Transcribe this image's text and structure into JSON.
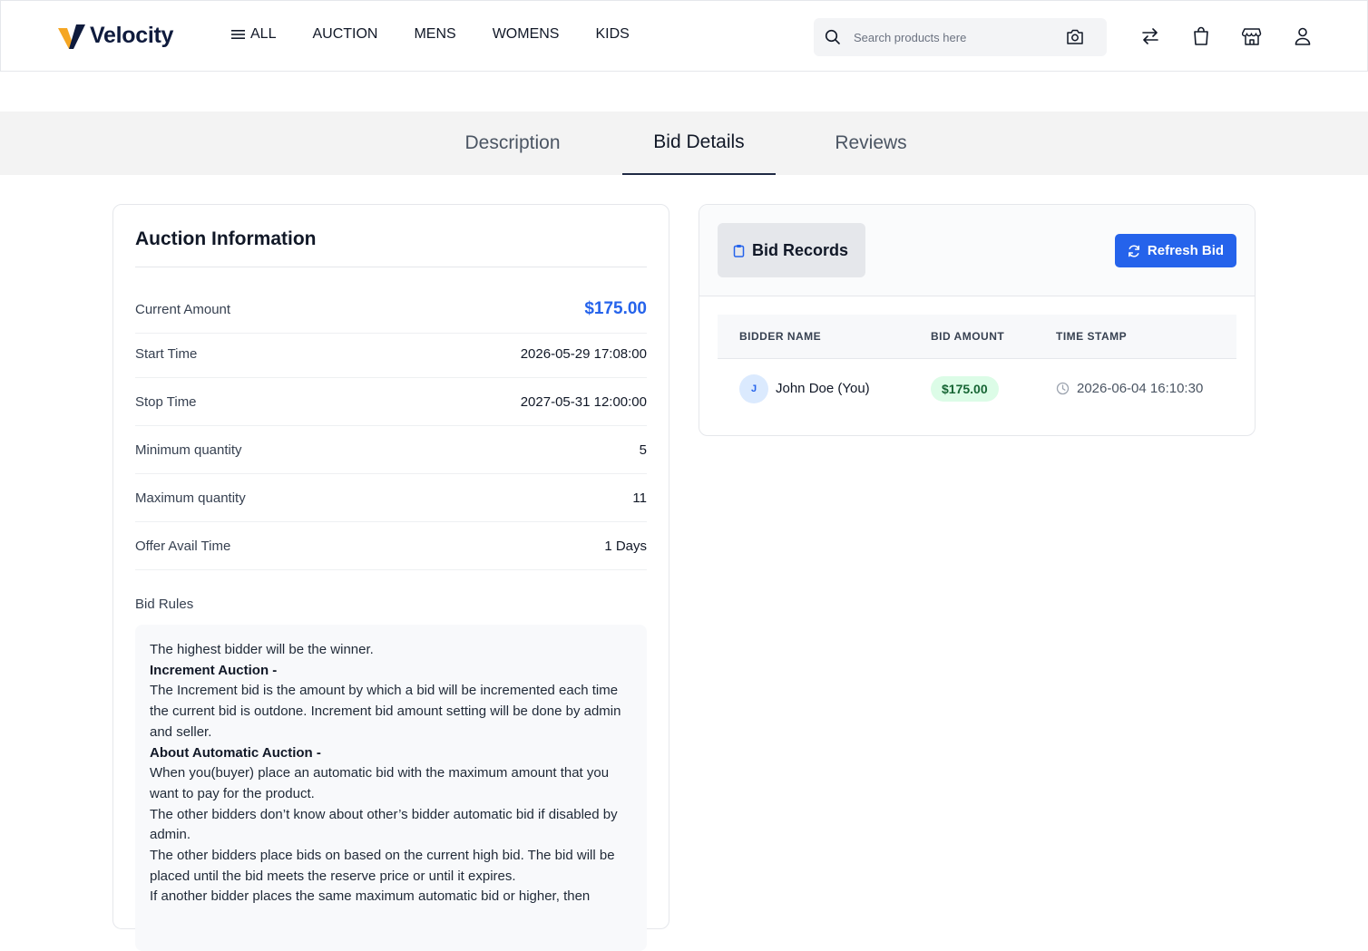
{
  "header": {
    "brand": "Velocity",
    "nav": [
      {
        "label": "ALL"
      },
      {
        "label": "AUCTION"
      },
      {
        "label": "MENS"
      },
      {
        "label": "WOMENS"
      },
      {
        "label": "KIDS"
      }
    ],
    "search_placeholder": "Search products here",
    "icons": [
      "search-icon",
      "camera-icon",
      "compare-icon",
      "bag-icon",
      "store-icon",
      "user-icon"
    ]
  },
  "tabs": [
    {
      "label": "Description"
    },
    {
      "label": "Bid Details",
      "active": true
    },
    {
      "label": "Reviews"
    }
  ],
  "auction": {
    "title": "Auction Information",
    "rows": [
      {
        "label": "Current Amount",
        "value": "$175.00"
      },
      {
        "label": "Start Time",
        "value": "2026-05-29 17:08:00"
      },
      {
        "label": "Stop Time",
        "value": "2027-05-31 12:00:00"
      },
      {
        "label": "Minimum quantity",
        "value": "5"
      },
      {
        "label": "Maximum quantity",
        "value": "11"
      },
      {
        "label": "Offer Avail Time",
        "value": "1 Days"
      }
    ],
    "rules_label": "Bid Rules",
    "rules": [
      "The highest bidder will be the winner.",
      "Increment Auction -",
      "The Increment bid is the amount by which a bid will be incremented each time the current bid is outdone. Increment bid amount setting will be done by admin and seller.",
      "About Automatic Auction -",
      "When you(buyer) place an automatic bid with the maximum amount that you want to pay for the product.",
      "The other bidders don’t know about other’s bidder automatic bid if disabled by admin.",
      "The other bidders place bids on based on the current high bid. The bid will be placed until the bid meets the reserve price or until it expires.",
      "If another bidder places the same maximum automatic bid or higher, then"
    ]
  },
  "bids": {
    "title": "Bid Records",
    "refresh_label": "Refresh Bid",
    "columns": [
      "BIDDER NAME",
      "BID AMOUNT",
      "TIME STAMP"
    ],
    "rows": [
      {
        "initial": "J",
        "name": "John Doe (You)",
        "amount": "$175.00",
        "time": "2026-06-04 16:10:30"
      }
    ]
  },
  "colors": {
    "accent": "#2563eb",
    "logo_orange": "#f5a623",
    "logo_navy": "#0f1b3d",
    "pill_bg": "#dcfce7",
    "pill_text": "#166534"
  }
}
